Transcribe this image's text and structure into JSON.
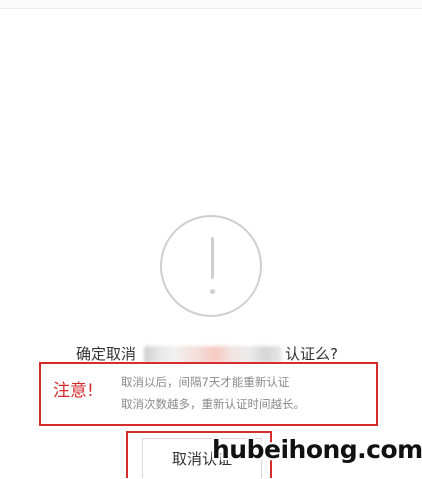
{
  "dialog": {
    "confirm_prefix": "确定取消",
    "confirm_suffix": "认证么?",
    "icon": "exclamation-circle-icon"
  },
  "notice": {
    "title": "注意!",
    "line1": "取消以后，间隔7天才能重新认证",
    "line2": "取消次数越多，重新认证时间越长。"
  },
  "actions": {
    "cancel_verification_label": "取消认证"
  },
  "watermark": {
    "text": "hubeihong.com"
  },
  "colors": {
    "highlight_red": "#d62c2c",
    "icon_gray": "#cfcfcf",
    "hint_gray": "#8a8a8a"
  }
}
